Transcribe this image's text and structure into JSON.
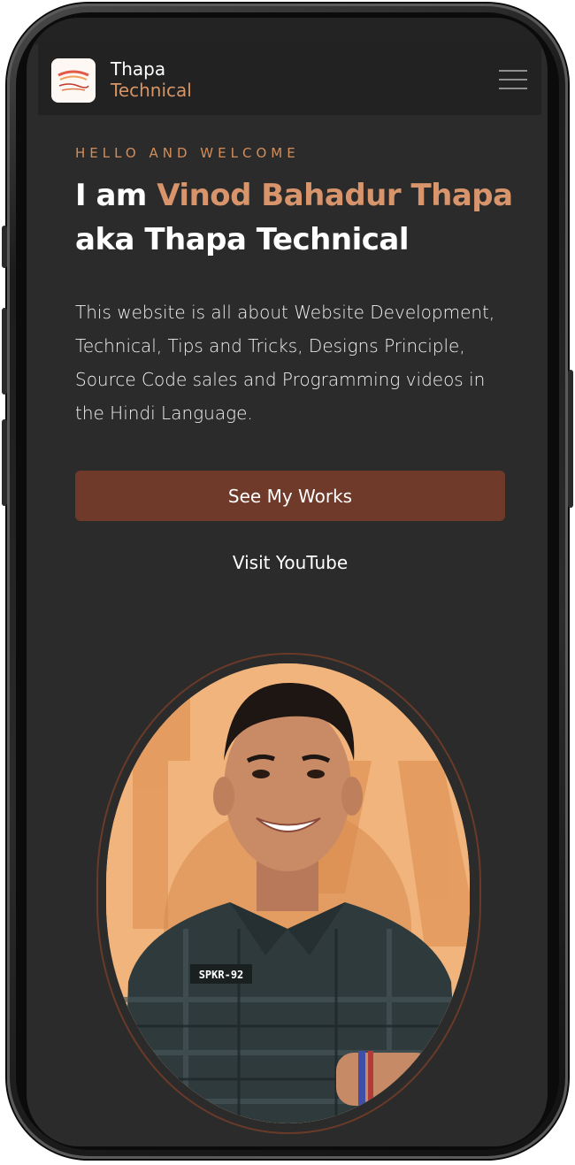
{
  "brand": {
    "name_line1": "Thapa",
    "name_line2": "Technical",
    "logo_text": "Thapa Technical",
    "accent_color": "#d8946a"
  },
  "navbar": {
    "menu_icon": "hamburger-menu-icon"
  },
  "hero": {
    "tagline": "HELLO AND WELCOME",
    "headline_prefix": "I am ",
    "headline_name": "Vinod Bahadur Thapa",
    "headline_suffix": "aka Thapa Technical",
    "description": "This website is all about Website Development, Technical, Tips and Tricks, Designs Principle, Source Code sales and Programming videos in the Hindi Language.",
    "primary_button": "See My Works",
    "secondary_link": "Visit YouTube",
    "button_color": "#6f3a2a"
  },
  "portrait": {
    "badge_text": "SPKR-92",
    "background_letters": "THAPA"
  },
  "colors": {
    "page_background": "#2b2b2b",
    "navbar_background": "#222222",
    "portrait_background": "#f0b47c"
  }
}
